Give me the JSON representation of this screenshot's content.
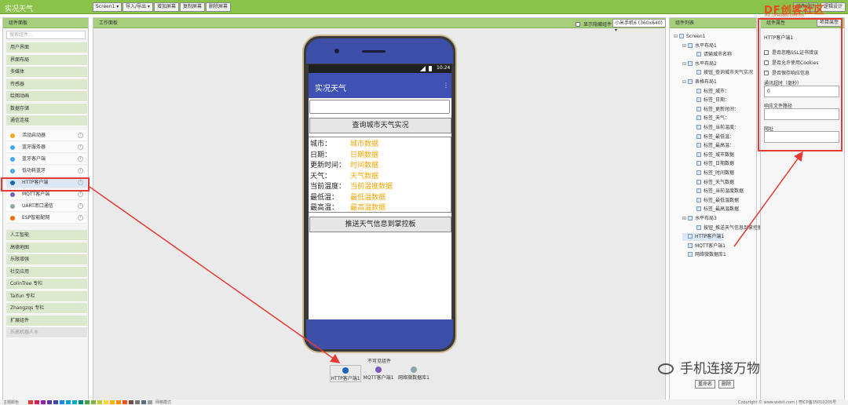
{
  "app": {
    "title": "实况天气"
  },
  "toolbar": {
    "screen": "Screen1 ▾",
    "import": "导入/导出 ▾",
    "add_screen": "增加屏幕",
    "copy_screen": "复制屏幕",
    "delete_screen": "删除屏幕",
    "designer": "组件设计",
    "blocks": "逻辑设计",
    "logo": "DF创客社区",
    "logo_sub": "mc.DFRobot.com.cn"
  },
  "palette": {
    "title": "组件面板",
    "search_placeholder": "搜索组件...",
    "categories_top": [
      "用户界面",
      "界面布局",
      "多媒体",
      "传感器",
      "绘图动画",
      "数据存储",
      "通信连接"
    ],
    "connect_items": [
      "活动启动器",
      "蓝牙服务器",
      "蓝牙客户端",
      "低功耗蓝牙",
      "HTTP客户端",
      "MQTT客户端",
      "UART串口通信",
      "ESP智能配网"
    ],
    "categories_bottom": [
      "人工智能",
      "高德地图",
      "乐限增强",
      "社交应用",
      "ColinTree 专栏",
      "Taifun 专栏",
      "Zhangzqs 专栏",
      "扩展组件",
      "乐高机器人®"
    ]
  },
  "viewer": {
    "title": "工作面板",
    "show_nonvisible": "显示隐藏组件",
    "device": "小米手机6 (360x640) ▾",
    "status_time": "10:24",
    "app_title": "实况天气",
    "menu_dots": "⋮",
    "query_button": "查询城市天气实况",
    "push_button": "推送天气信息到掌控板",
    "labels": [
      "城市：",
      "日期：",
      "更新时间：",
      "天气：",
      "当前温度：",
      "最低温：",
      "最高温："
    ],
    "values": [
      "城市数据",
      "日期数据",
      "时间数据",
      "天气数据",
      "当前温度数据",
      "最低温数据",
      "最高温数据"
    ],
    "nonvisible_title": "不可见组件",
    "nonvisible": [
      "HTTP客户端1",
      "MQTT客户端1",
      "网络微数据库1"
    ]
  },
  "tree": {
    "title": "组件列表",
    "items": [
      "Screen1",
      "水平布局1",
      "请输城市名称",
      "水平布局2",
      "按钮_查询城市天气实况",
      "表格布局1",
      "标签_城市：",
      "标签_日期：",
      "标签_更新时间：",
      "标签_天气：",
      "标签_当前温度：",
      "标签_最低温：",
      "标签_最高温：",
      "标签_城市数据",
      "标签_日期数据",
      "标签_时间数据",
      "标签_天气数据",
      "标签_当前温度数据",
      "标签_最低温数据",
      "标签_最高温数据",
      "水平布局3",
      "按钮_推送天气信息到掌控板",
      "HTTP客户端1",
      "MQTT客户端1",
      "网络微数据库1"
    ],
    "rename": "重命名",
    "delete": "删除"
  },
  "props": {
    "title": "组件属性",
    "project_props": "项目属性",
    "component": "HTTP客户端1",
    "chk1": "是否忽略SSL证书错误",
    "chk2": "是否允许使用Cookies",
    "chk3": "是否保存响应信息",
    "timeout_label": "通讯超时（毫秒）",
    "timeout_value": "0",
    "file_label": "响应文件路径",
    "url_label": "网址"
  },
  "footer": {
    "theme": "主题颜色",
    "grid": "网格模式",
    "copyright": "Copyright © www.wxbit.com | 粤ICP备15010205号"
  },
  "watermark": "手机连接万物",
  "colors": {
    "accent": "#8bc34a",
    "appbar": "#3f51b5",
    "highlight": "#e53935",
    "value_text": "#f0a400"
  }
}
